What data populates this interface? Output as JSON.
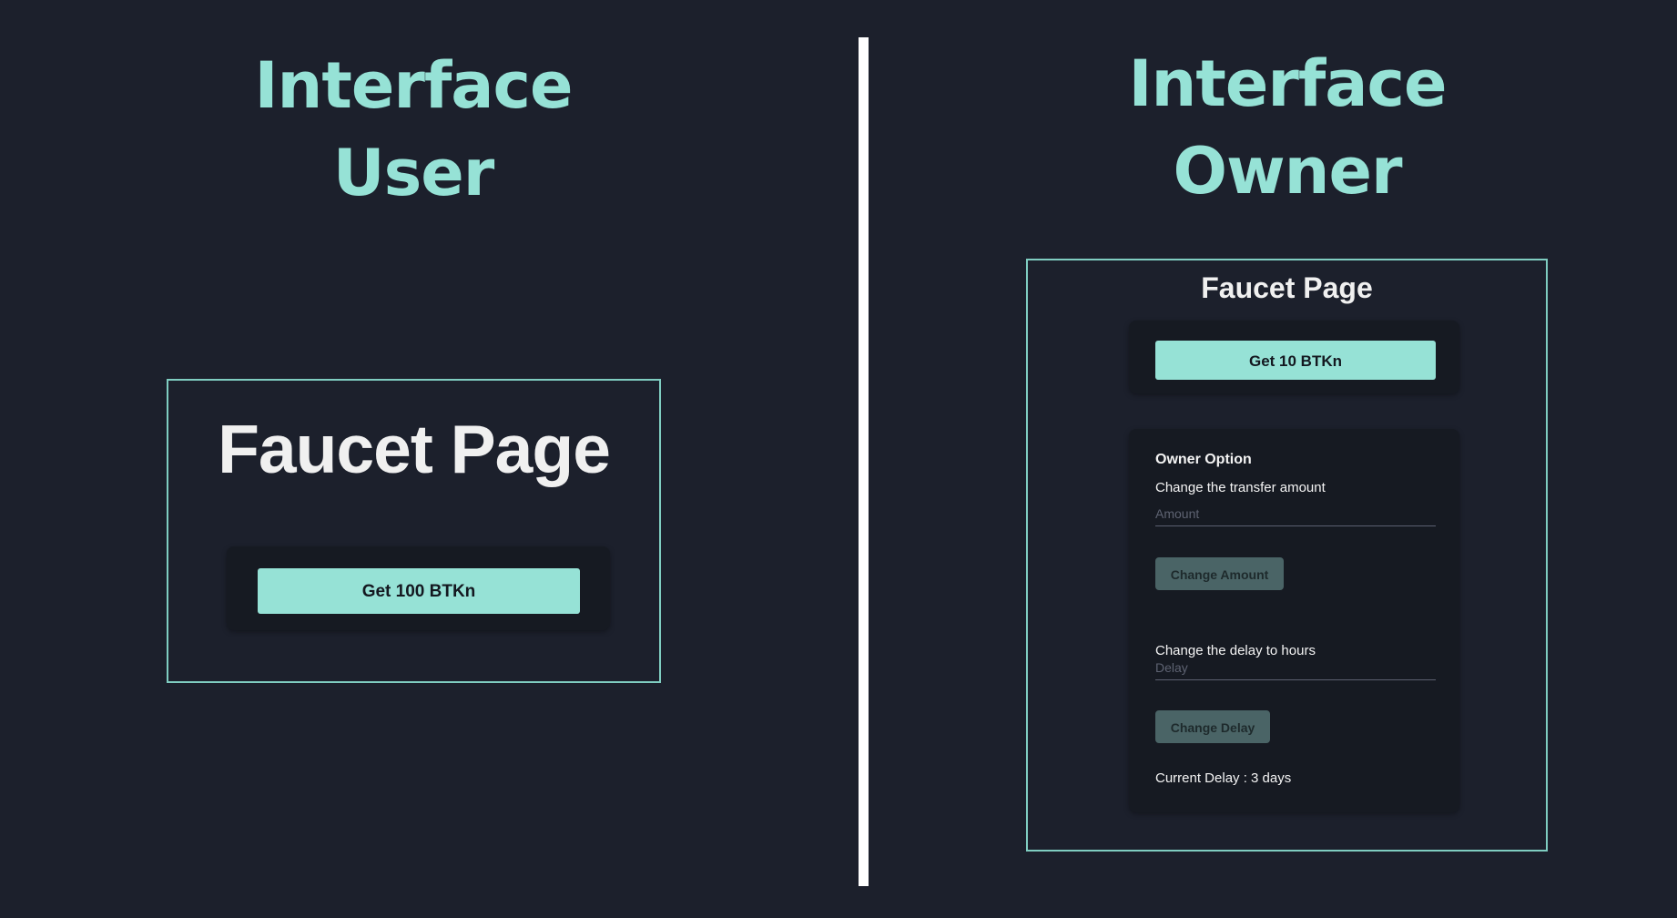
{
  "left_panel": {
    "heading_line1": "Interface",
    "heading_line2": "User",
    "page_title": "Faucet Page",
    "get_button_label": "Get 100 BTKn"
  },
  "right_panel": {
    "heading_line1": "Interface",
    "heading_line2": "Owner",
    "page_title": "Faucet Page",
    "get_button_label": "Get 10 BTKn",
    "owner_options": {
      "section_title": "Owner Option",
      "amount_label": "Change the transfer amount",
      "amount_placeholder": "Amount",
      "amount_button_label": "Change Amount",
      "delay_label": "Change the delay to hours",
      "delay_placeholder": "Delay",
      "delay_button_label": "Change Delay",
      "current_delay_text": "Current Delay : 3 days"
    }
  },
  "colors": {
    "background": "#1c202c",
    "accent": "#96e2d6",
    "frame_border": "#7fcdc1",
    "card": "#161a22",
    "divider": "#ffffff",
    "secondary_button": "#4a6466"
  }
}
